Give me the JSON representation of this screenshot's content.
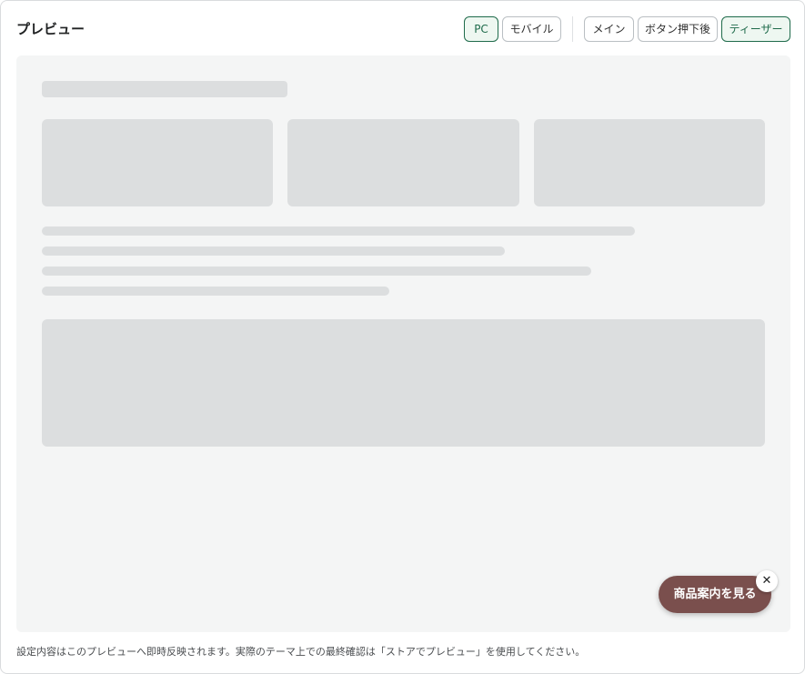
{
  "header": {
    "title": "プレビュー"
  },
  "device_toggle": {
    "pc_label": "PC",
    "mobile_label": "モバイル",
    "selected": "PC"
  },
  "view_toggle": {
    "main_label": "メイン",
    "after_button_label": "ボタン押下後",
    "teaser_label": "ティーザー",
    "selected": "ティーザー"
  },
  "preview": {
    "teaser_button_label": "商品案内を見る",
    "close_symbol": "✕",
    "teaser_color": "#7a4f4d"
  },
  "footer": {
    "note": "設定内容はこのプレビューへ即時反映されます。実際のテーマ上での最終確認は「ストアでプレビュー」を使用してください。"
  },
  "colors": {
    "accent": "#1f6b4b",
    "active_bg": "#eef7f1",
    "skeleton": "#dcdedf"
  }
}
